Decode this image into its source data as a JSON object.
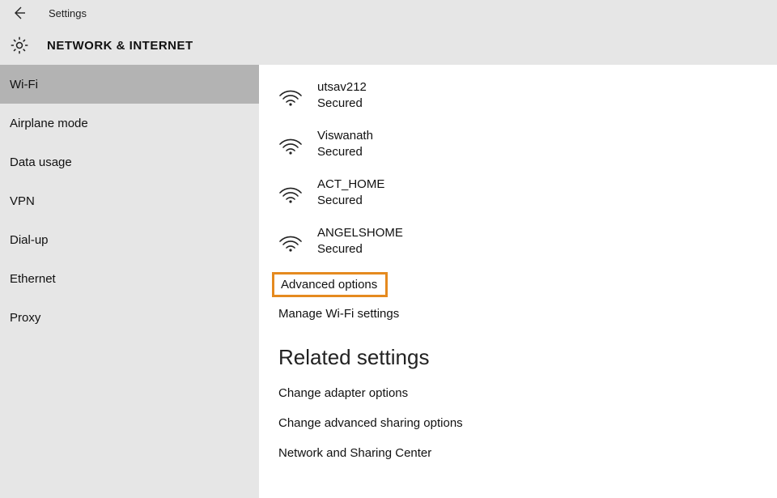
{
  "titlebar": {
    "title": "Settings"
  },
  "header": {
    "heading": "NETWORK & INTERNET"
  },
  "sidebar": {
    "items": [
      {
        "label": "Wi-Fi",
        "active": true
      },
      {
        "label": "Airplane mode",
        "active": false
      },
      {
        "label": "Data usage",
        "active": false
      },
      {
        "label": "VPN",
        "active": false
      },
      {
        "label": "Dial-up",
        "active": false
      },
      {
        "label": "Ethernet",
        "active": false
      },
      {
        "label": "Proxy",
        "active": false
      }
    ]
  },
  "content": {
    "networks": [
      {
        "name": "utsav212",
        "status": "Secured"
      },
      {
        "name": "Viswanath",
        "status": "Secured"
      },
      {
        "name": "ACT_HOME",
        "status": "Secured"
      },
      {
        "name": "ANGELSHOME",
        "status": "Secured"
      }
    ],
    "links": {
      "advanced_options": "Advanced options",
      "manage_wifi": "Manage Wi-Fi settings"
    },
    "related_heading": "Related settings",
    "related": [
      "Change adapter options",
      "Change advanced sharing options",
      "Network and Sharing Center"
    ]
  },
  "highlighted_link": "advanced_options"
}
